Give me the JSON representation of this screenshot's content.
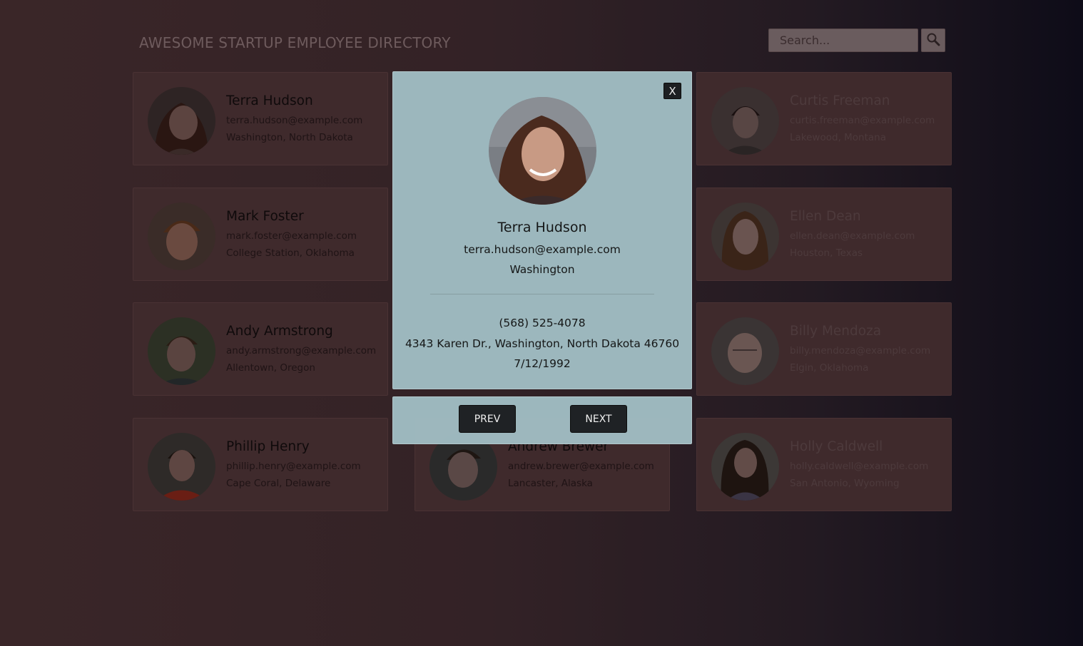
{
  "header": {
    "title": "AWESOME STARTUP EMPLOYEE DIRECTORY",
    "search_placeholder": "Search..."
  },
  "icons": {
    "search": "search-icon",
    "close": "close-icon"
  },
  "employees": [
    {
      "name": "Terra Hudson",
      "email": "terra.hudson@example.com",
      "location": "Washington, North Dakota"
    },
    {
      "name": "Curtis Freeman",
      "email": "curtis.freeman@example.com",
      "location": "Lakewood, Montana"
    },
    {
      "name": "Mark Foster",
      "email": "mark.foster@example.com",
      "location": "College Station, Oklahoma"
    },
    {
      "name": "Ellen Dean",
      "email": "ellen.dean@example.com",
      "location": "Houston, Texas"
    },
    {
      "name": "Andy Armstrong",
      "email": "andy.armstrong@example.com",
      "location": "Allentown, Oregon"
    },
    {
      "name": "Billy Mendoza",
      "email": "billy.mendoza@example.com",
      "location": "Elgin, Oklahoma"
    },
    {
      "name": "Phillip Henry",
      "email": "phillip.henry@example.com",
      "location": "Cape Coral, Delaware"
    },
    {
      "name": "Andrew Brewer",
      "email": "andrew.brewer@example.com",
      "location": "Lancaster, Alaska"
    },
    {
      "name": "Holly Caldwell",
      "email": "holly.caldwell@example.com",
      "location": "San Antonio, Wyoming"
    }
  ],
  "modal": {
    "close_label": "X",
    "name": "Terra Hudson",
    "email": "terra.hudson@example.com",
    "city": "Washington",
    "phone": "(568) 525-4078",
    "address": "4343 Karen Dr., Washington, North Dakota 46760",
    "birthday": "7/12/1992"
  },
  "nav": {
    "prev_label": "PREV",
    "next_label": "NEXT"
  },
  "colors": {
    "modal_bg": "#a0bcc2",
    "button_bg": "#1f2225",
    "card_bg": "#3f2a2c"
  }
}
